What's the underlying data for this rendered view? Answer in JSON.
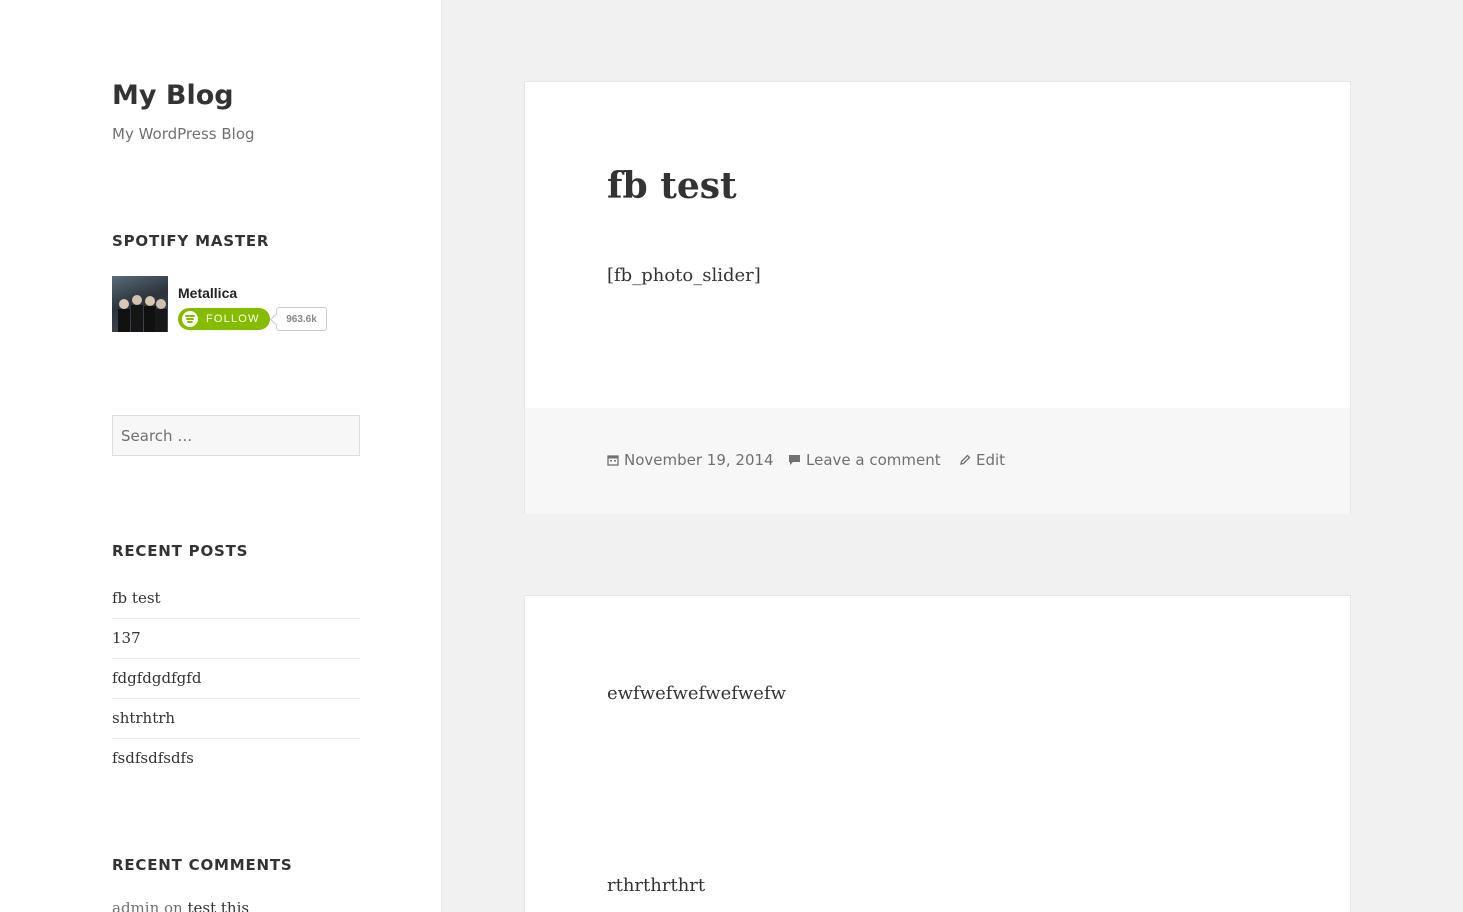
{
  "site": {
    "title": "My Blog",
    "description": "My WordPress Blog"
  },
  "spotify_widget": {
    "heading": "Spotify Master",
    "artist": "Metallica",
    "follow_label": "FOLLOW",
    "follower_count": "963.6k",
    "accent_color": "#84bd00"
  },
  "search": {
    "placeholder": "Search …"
  },
  "recent_posts": {
    "heading": "Recent Posts",
    "items": [
      "fb test",
      "137",
      "fdgfdgdfgfd",
      "shtrhtrh",
      "fsdfsdfsdfs"
    ]
  },
  "recent_comments": {
    "heading": "Recent Comments",
    "first_author": "admin",
    "first_on": "on",
    "first_post": "test this"
  },
  "posts": [
    {
      "title": "fb test",
      "body": "[fb_photo_slider]",
      "date": "November 19, 2014",
      "comment_link": "Leave a comment",
      "edit_link": "Edit"
    },
    {
      "para1": "ewfwefwefwefwefw",
      "para2": "rthrthrthrt"
    }
  ]
}
